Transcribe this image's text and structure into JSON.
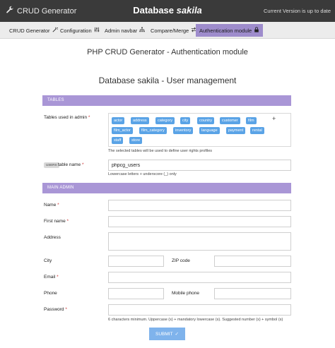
{
  "topbar": {
    "app_name": "CRUD Generator",
    "db_prefix": "Database",
    "db_name": "sakila",
    "version_status": "Current Version is up to date"
  },
  "nav": {
    "items": [
      {
        "label": "CRUD Generator",
        "icon": "wand-icon"
      },
      {
        "label": "Configuration",
        "icon": "sliders-icon"
      },
      {
        "label": "Admin navbar",
        "icon": "sitemap-icon"
      },
      {
        "label": "Compare/Merge",
        "icon": "compare-icon"
      },
      {
        "label": "Authentication module",
        "icon": "lock-icon"
      }
    ],
    "active_index": 4
  },
  "headings": {
    "main": "PHP CRUD Generator - Authentication module",
    "sub": "Database sakila - User management"
  },
  "sections": {
    "tables": "TABLES",
    "main_admin": "MAIN ADMIN"
  },
  "tables_field": {
    "label": "Tables used in admin",
    "required_mark": "*",
    "tags": [
      "actor",
      "address",
      "category",
      "city",
      "country",
      "customer",
      "film",
      "film_actor",
      "film_category",
      "inventory",
      "language",
      "payment",
      "rental",
      "staff",
      "store"
    ],
    "add_symbol": "+",
    "hint": "The selected tables will be used to define user rights profiles"
  },
  "users_table": {
    "badge": "USERS",
    "label": "table name",
    "required_mark": "*",
    "value": "phpcg_users",
    "hint": "Lowercase letters + underscore (_) only"
  },
  "admin": {
    "name_label": "Name",
    "firstname_label": "First name",
    "address_label": "Address",
    "city_label": "City",
    "zip_label": "ZIP code",
    "email_label": "Email",
    "phone_label": "Phone",
    "mobile_label": "Mobile phone",
    "password_label": "Password",
    "required_mark": "*",
    "password_hint": "6 characters minimum. Uppercase (s) + mandatory lowercase (s). Suggested number (s) + symbol (s)"
  },
  "submit": {
    "label": "SUBMIT",
    "check": "✓"
  },
  "colors": {
    "topbar": "#3a3a3a",
    "accent": "#a996d6",
    "tag": "#5aa3e6",
    "submit": "#7fb3ec"
  }
}
